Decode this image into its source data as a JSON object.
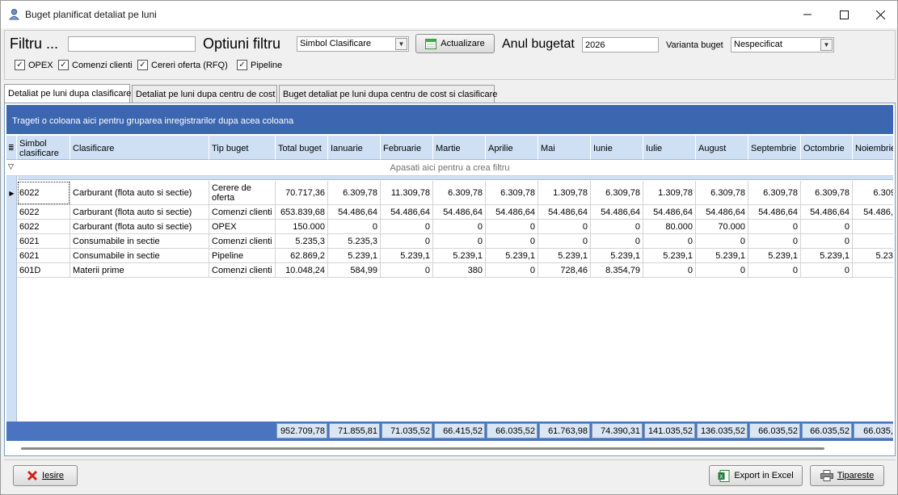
{
  "window": {
    "title": "Buget planificat detaliat pe luni",
    "minimize_icon": "minimize-icon",
    "maximize_icon": "maximize-icon",
    "close_icon": "close-icon"
  },
  "filter": {
    "filter_label": "Filtru ...",
    "filter_value": "",
    "options_label": "Optiuni filtru",
    "options_selected": "Simbol Clasificare",
    "refresh_button": "Actualizare",
    "year_label": "Anul bugetat",
    "year_value": "2026",
    "variant_label": "Varianta buget",
    "variant_selected": "Nespecificat",
    "checkboxes": [
      {
        "label": "OPEX",
        "checked": true
      },
      {
        "label": "Comenzi clienti",
        "checked": true
      },
      {
        "label": "Cereri oferta (RFQ)",
        "checked": true
      },
      {
        "label": "Pipeline",
        "checked": true
      }
    ]
  },
  "tabs": [
    {
      "label": "Detaliat pe luni dupa clasificare",
      "active": true
    },
    {
      "label": "Detaliat pe luni dupa centru de cost",
      "active": false
    },
    {
      "label": "Buget detaliat pe luni dupa centru de cost si clasificare",
      "active": false
    }
  ],
  "grid": {
    "group_hint": "Trageti o coloana aici pentru gruparea inregistrarilor dupa acea coloana",
    "filter_hint": "Apasati aici pentru a  crea filtru",
    "columns": [
      "Simbol clasificare",
      "Clasificare",
      "Tip buget",
      "Total buget",
      "Ianuarie",
      "Februarie",
      "Martie",
      "Aprilie",
      "Mai",
      "Iunie",
      "Iulie",
      "August",
      "Septembrie",
      "Octombrie",
      "Noiembrie"
    ],
    "rows": [
      [
        "6022",
        "Carburant (flota auto si sectie)",
        "Cerere de oferta",
        "70.717,36",
        "6.309,78",
        "11.309,78",
        "6.309,78",
        "6.309,78",
        "1.309,78",
        "6.309,78",
        "1.309,78",
        "6.309,78",
        "6.309,78",
        "6.309,78",
        "6.309,"
      ],
      [
        "6022",
        "Carburant (flota auto si sectie)",
        "Comenzi clienti",
        "653.839,68",
        "54.486,64",
        "54.486,64",
        "54.486,64",
        "54.486,64",
        "54.486,64",
        "54.486,64",
        "54.486,64",
        "54.486,64",
        "54.486,64",
        "54.486,64",
        "54.486,6"
      ],
      [
        "6022",
        "Carburant (flota auto si sectie)",
        "OPEX",
        "150.000",
        "0",
        "0",
        "0",
        "0",
        "0",
        "0",
        "80.000",
        "70.000",
        "0",
        "0",
        ""
      ],
      [
        "6021",
        "Consumabile in sectie",
        "Comenzi clienti",
        "5.235,3",
        "5.235,3",
        "0",
        "0",
        "0",
        "0",
        "0",
        "0",
        "0",
        "0",
        "0",
        ""
      ],
      [
        "6021",
        "Consumabile in sectie",
        "Pipeline",
        "62.869,2",
        "5.239,1",
        "5.239,1",
        "5.239,1",
        "5.239,1",
        "5.239,1",
        "5.239,1",
        "5.239,1",
        "5.239,1",
        "5.239,1",
        "5.239,1",
        "5.239"
      ],
      [
        "601D",
        "Materii prime",
        "Comenzi clienti",
        "10.048,24",
        "584,99",
        "0",
        "380",
        "0",
        "728,46",
        "8.354,79",
        "0",
        "0",
        "0",
        "0",
        ""
      ]
    ],
    "totals": [
      "952.709,78",
      "71.855,81",
      "71.035,52",
      "66.415,52",
      "66.035,52",
      "61.763,98",
      "74.390,31",
      "141.035,52",
      "136.035,52",
      "66.035,52",
      "66.035,52",
      "66.035,5"
    ]
  },
  "bottom": {
    "exit_button": "Iesire",
    "export_button": "Export in Excel",
    "print_button": "Tipareste"
  }
}
